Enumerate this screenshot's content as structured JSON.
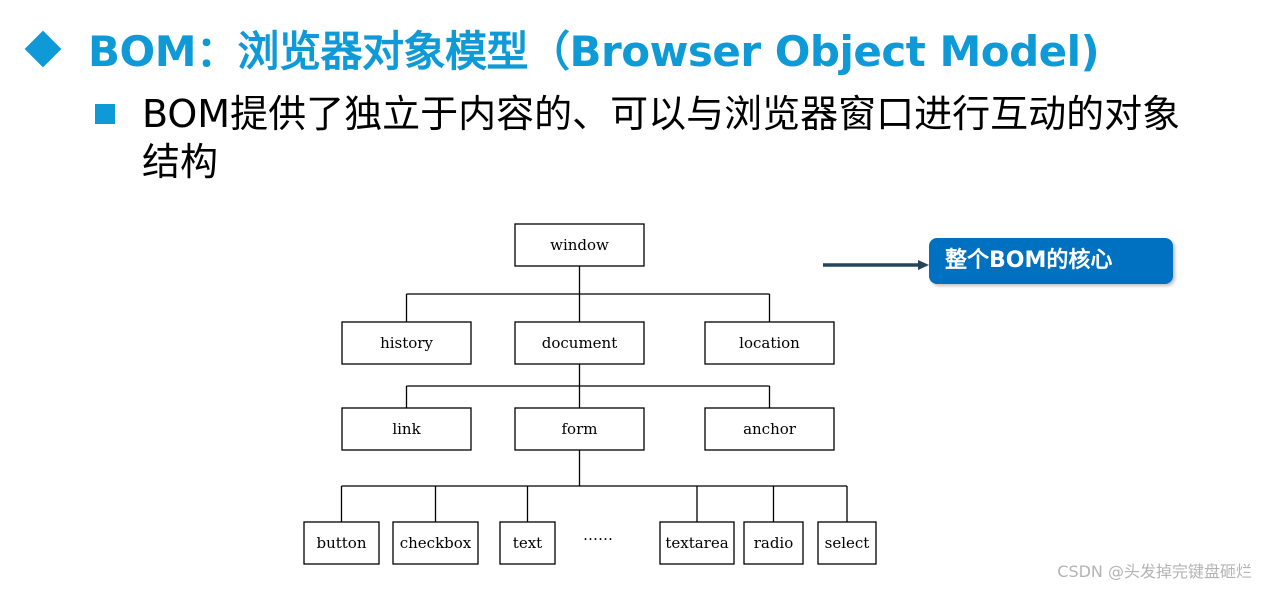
{
  "slide": {
    "title": "BOM：浏览器对象模型（Browser Object Model)",
    "bullet": "BOM提供了独立于内容的、可以与浏览器窗口进行互动的对象结构",
    "accent_color": "#0e9ad7"
  },
  "diagram": {
    "root": "window",
    "level1": [
      "history",
      "document",
      "location"
    ],
    "level2": [
      "link",
      "form",
      "anchor"
    ],
    "level3": [
      "button",
      "checkbox",
      "text",
      "……",
      "textarea",
      "radio",
      "select"
    ],
    "edges": [
      [
        "window",
        "history"
      ],
      [
        "window",
        "document"
      ],
      [
        "window",
        "location"
      ],
      [
        "document",
        "link"
      ],
      [
        "document",
        "form"
      ],
      [
        "document",
        "anchor"
      ],
      [
        "form",
        "button"
      ],
      [
        "form",
        "checkbox"
      ],
      [
        "form",
        "text"
      ],
      [
        "form",
        "textarea"
      ],
      [
        "form",
        "radio"
      ],
      [
        "form",
        "select"
      ]
    ]
  },
  "callout": {
    "text": "整个BOM的核心",
    "points_to": "window",
    "color": "#0070c0"
  },
  "watermark": "CSDN @头发掉完键盘砸烂"
}
